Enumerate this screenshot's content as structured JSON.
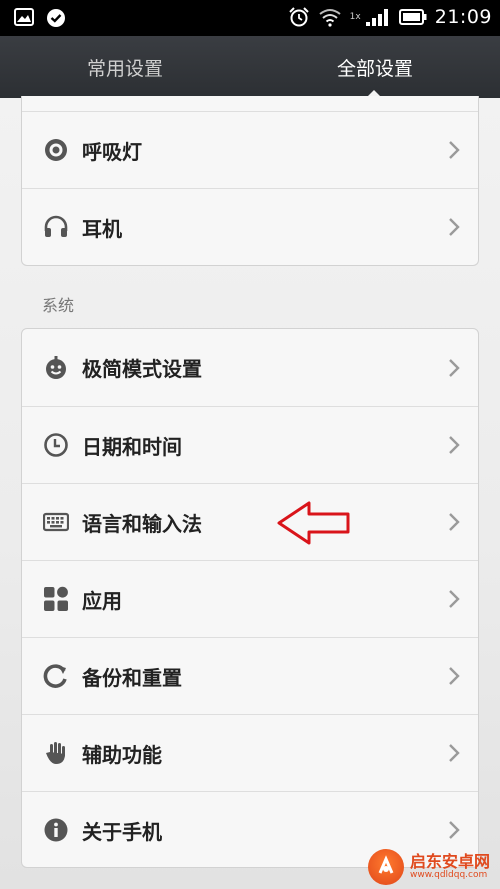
{
  "status_bar": {
    "time": "21:09",
    "network_label": "1x",
    "left_icons": [
      "image-notification-icon",
      "check-notification-icon"
    ],
    "right_icons": [
      "alarm-icon",
      "wifi-icon",
      "signal-icon",
      "battery-icon"
    ]
  },
  "tabs": [
    {
      "label": "常用设置",
      "active": false
    },
    {
      "label": "全部设置",
      "active": true
    }
  ],
  "cards": {
    "top_items": [
      {
        "label": "呼吸灯",
        "icon": "breathing-light-icon"
      },
      {
        "label": "耳机",
        "icon": "headphones-icon"
      }
    ]
  },
  "system_section": {
    "header": "系统",
    "items": [
      {
        "label": "极简模式设置",
        "icon": "simple-mode-icon"
      },
      {
        "label": "日期和时间",
        "icon": "clock-icon"
      },
      {
        "label": "语言和输入法",
        "icon": "keyboard-icon"
      },
      {
        "label": "应用",
        "icon": "apps-icon"
      },
      {
        "label": "备份和重置",
        "icon": "backup-icon"
      },
      {
        "label": "辅助功能",
        "icon": "hand-icon"
      },
      {
        "label": "关于手机",
        "icon": "info-icon"
      }
    ]
  },
  "annotation": {
    "color": "#d9141a",
    "points_to": "语言和输入法"
  },
  "watermark": {
    "title": "启东安卓网",
    "url": "www.qdldqq.com"
  },
  "colors": {
    "tabbar": "#33363a",
    "icon": "#555555",
    "chevron": "#9a9a9a",
    "accent": "#d9141a"
  }
}
